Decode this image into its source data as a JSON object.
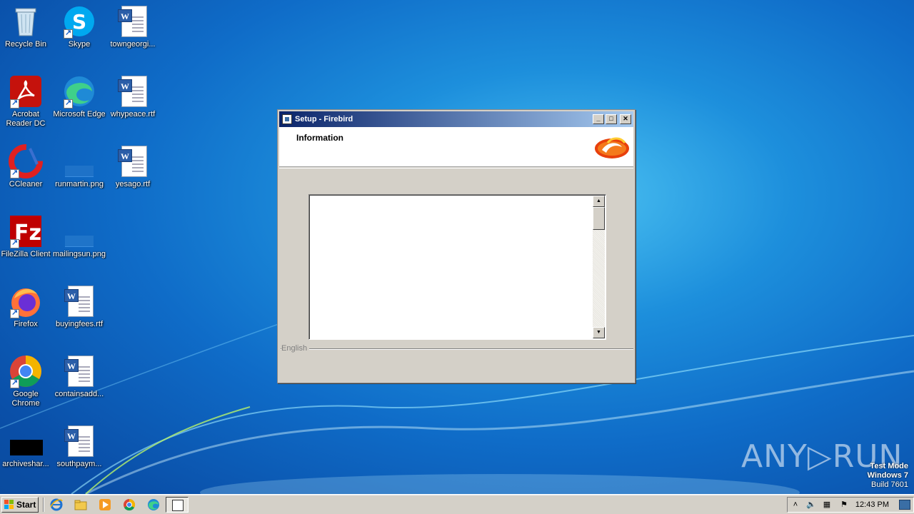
{
  "desktop": {
    "icons": [
      {
        "label": "Recycle Bin"
      },
      {
        "label": "Skype"
      },
      {
        "label": "towngeorgi..."
      },
      {
        "label": "Acrobat Reader DC"
      },
      {
        "label": "Microsoft Edge"
      },
      {
        "label": "whypeace.rtf"
      },
      {
        "label": "CCleaner"
      },
      {
        "label": "runmartin.png"
      },
      {
        "label": "yesago.rtf"
      },
      {
        "label": "FileZilla Client"
      },
      {
        "label": "mailingsun.png"
      },
      {
        "label": "Firefox"
      },
      {
        "label": "buyingfees.rtf"
      },
      {
        "label": "Google Chrome"
      },
      {
        "label": "containsadd..."
      },
      {
        "label": "archiveshar..."
      },
      {
        "label": "southpaym..."
      }
    ]
  },
  "window": {
    "title": "Setup - Firebird",
    "heading": "Information",
    "language": "English",
    "buttons": {
      "minimize": "_",
      "maximize": "□",
      "close": "✕"
    }
  },
  "watermark": {
    "brand": "ANY▷RUN",
    "line1": "Test Mode",
    "line2": "Windows 7",
    "line3": "Build 7601"
  },
  "taskbar": {
    "start_label": "Start",
    "clock": "12:43 PM"
  }
}
